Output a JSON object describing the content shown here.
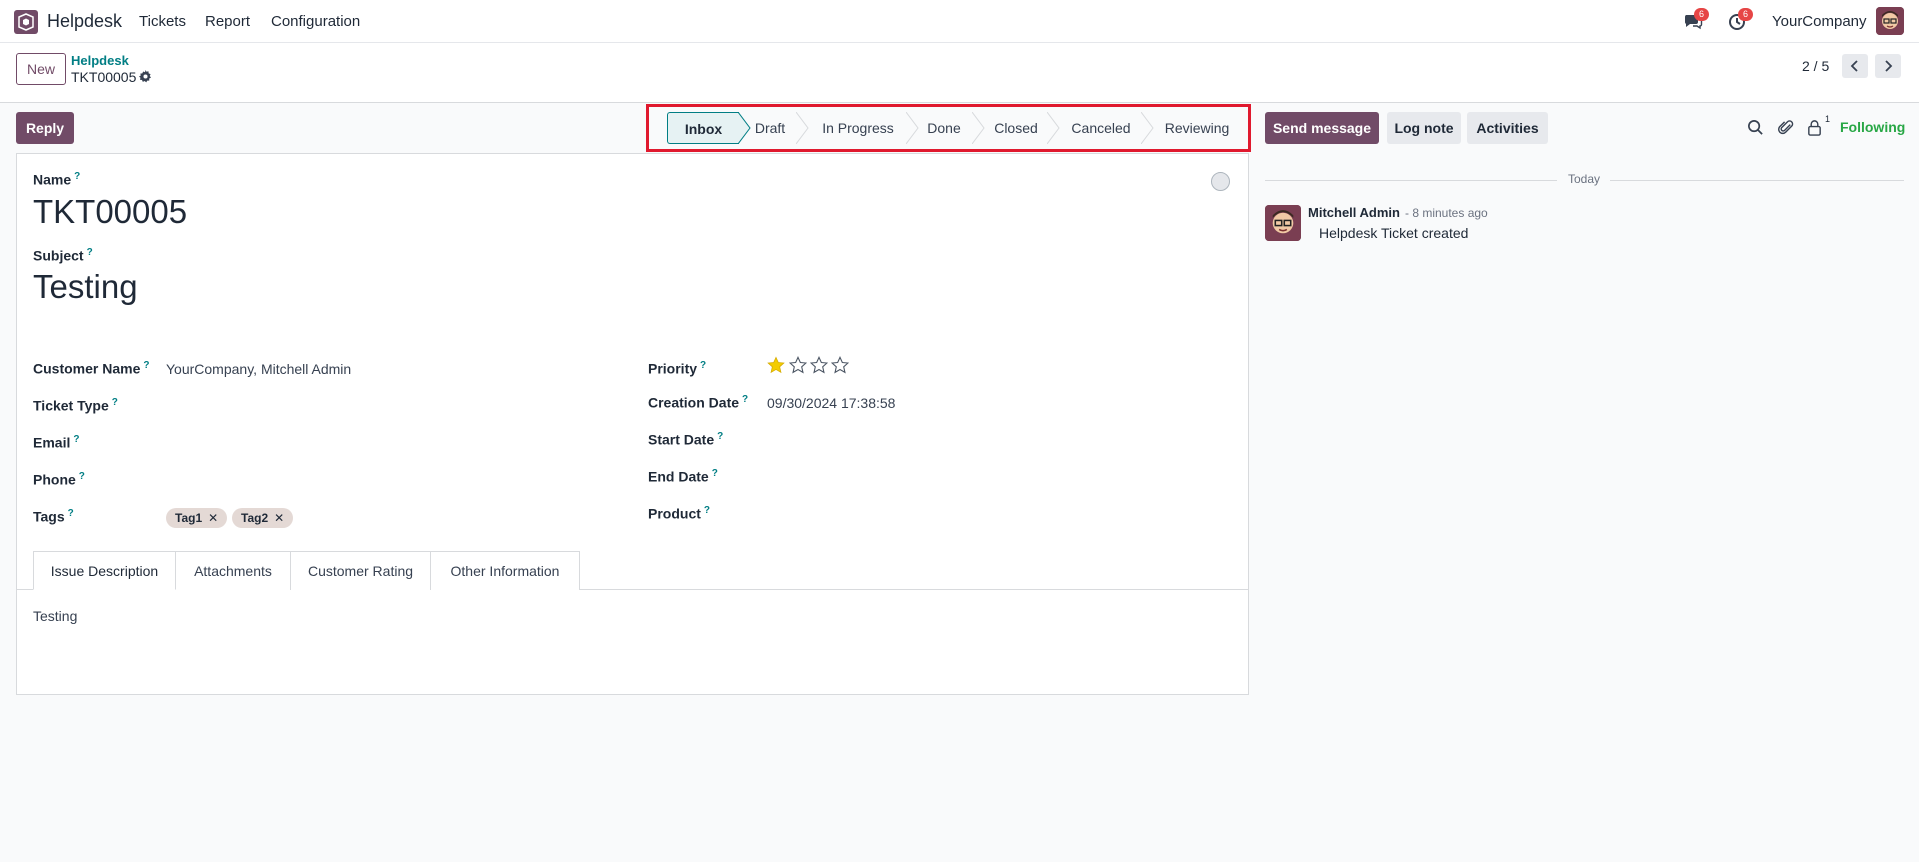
{
  "navbar": {
    "app_name": "Helpdesk",
    "menus": [
      "Tickets",
      "Report",
      "Configuration"
    ],
    "messages_badge": "6",
    "activities_badge": "6",
    "company": "YourCompany"
  },
  "control_panel": {
    "new_label": "New",
    "breadcrumb_parent": "Helpdesk",
    "breadcrumb_current": "TKT00005",
    "pager": "2 / 5"
  },
  "statusbar": {
    "reply_label": "Reply",
    "stages": [
      "Inbox",
      "Draft",
      "In Progress",
      "Done",
      "Closed",
      "Canceled",
      "Reviewing"
    ],
    "active_stage": "Inbox"
  },
  "form": {
    "name_label": "Name",
    "name_value": "TKT00005",
    "subject_label": "Subject",
    "subject_value": "Testing",
    "help_mark": "?",
    "left_fields": [
      {
        "label": "Customer Name",
        "value": "YourCompany, Mitchell Admin"
      },
      {
        "label": "Ticket Type",
        "value": ""
      },
      {
        "label": "Email",
        "value": ""
      },
      {
        "label": "Phone",
        "value": ""
      },
      {
        "label": "Tags",
        "value": ""
      }
    ],
    "tags": [
      "Tag1",
      "Tag2"
    ],
    "tag_remove": "✕",
    "right_fields": [
      {
        "label": "Priority",
        "value": ""
      },
      {
        "label": "Creation Date",
        "value": "09/30/2024 17:38:58"
      },
      {
        "label": "Start Date",
        "value": ""
      },
      {
        "label": "End Date",
        "value": ""
      },
      {
        "label": "Product",
        "value": ""
      }
    ],
    "priority_stars": 1,
    "priority_max": 4,
    "tabs": [
      "Issue Description",
      "Attachments",
      "Customer Rating",
      "Other Information"
    ],
    "tab_content": "Testing"
  },
  "chatter": {
    "send_message": "Send message",
    "log_note": "Log note",
    "activities": "Activities",
    "follower_count": "1",
    "following": "Following",
    "date_separator": "Today",
    "message": {
      "author": "Mitchell Admin",
      "time": "- 8 minutes ago",
      "body": "Helpdesk Ticket created"
    }
  },
  "colors": {
    "brand": "#714b67",
    "accent": "#017e84",
    "highlight_box": "#e0192e",
    "following": "#28a745",
    "star_filled": "#f3cc00"
  }
}
